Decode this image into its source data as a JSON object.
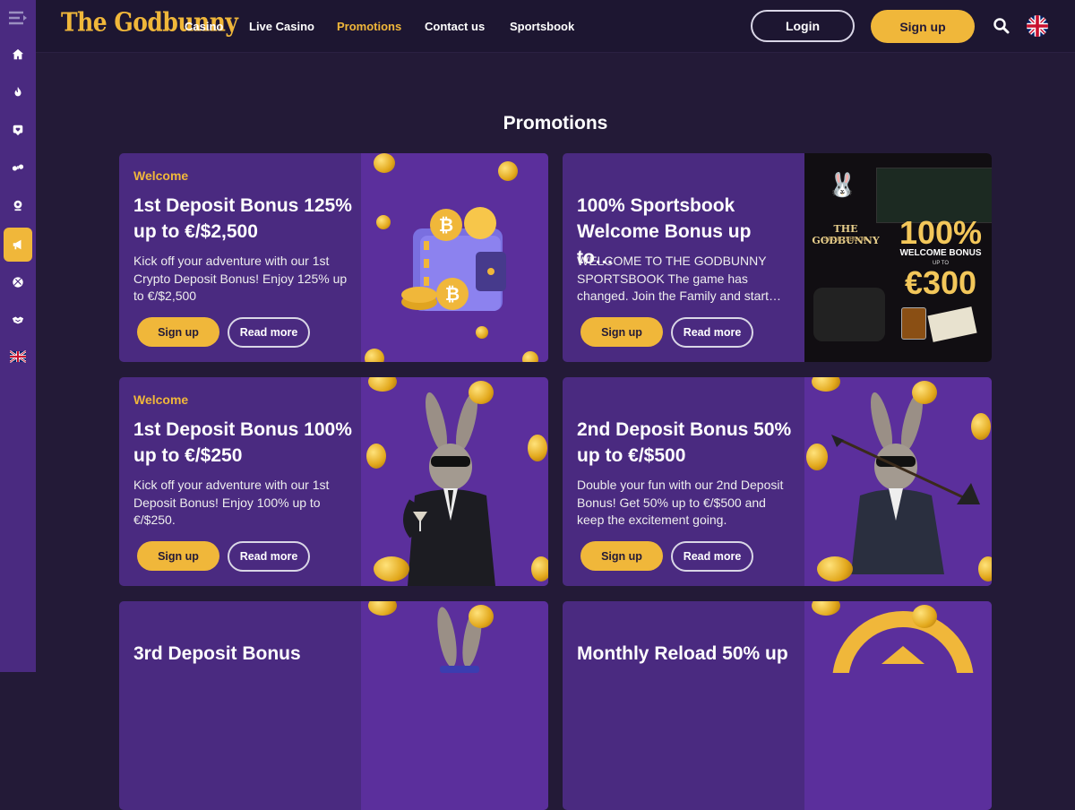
{
  "brand": {
    "logo_text": "The Godbunny"
  },
  "nav": {
    "items": [
      {
        "label": "Casino",
        "active": false
      },
      {
        "label": "Live Casino",
        "active": false
      },
      {
        "label": "Promotions",
        "active": true
      },
      {
        "label": "Contact us",
        "active": false
      },
      {
        "label": "Sportsbook",
        "active": false
      }
    ]
  },
  "header": {
    "login_label": "Login",
    "signup_label": "Sign up"
  },
  "sidebar": {
    "items": [
      {
        "icon": "menu-icon"
      },
      {
        "icon": "home-icon"
      },
      {
        "icon": "fire-icon"
      },
      {
        "icon": "heart-icon"
      },
      {
        "icon": "live-casino-icon"
      },
      {
        "icon": "slots-icon"
      },
      {
        "icon": "megaphone-icon",
        "active": true
      },
      {
        "icon": "sports-ball-icon"
      },
      {
        "icon": "handshake-icon"
      },
      {
        "icon": "uk-flag-icon"
      }
    ]
  },
  "page": {
    "title": "Promotions"
  },
  "promotions": [
    {
      "category": "Welcome",
      "title": "1st Deposit Bonus 125% up to €/$2,500",
      "description": "Kick off your adventure with our 1st Crypto Deposit Bonus! Enjoy 125% up to €/$2,500",
      "signup_label": "Sign up",
      "read_more_label": "Read more"
    },
    {
      "category": "",
      "title": "100% Sportsbook Welcome Bonus up to…",
      "description": "WELCOME TO THE GODBUNNY SPORTSBOOK The game has changed. Join the Family and start…",
      "signup_label": "Sign up",
      "read_more_label": "Read more",
      "art": {
        "brand": "THE GODBUNNY",
        "brand_sub": "SPORTSBOOK",
        "percent": "100%",
        "line1": "WELCOME BONUS",
        "line2": "UP TO",
        "amount": "€300"
      }
    },
    {
      "category": "Welcome",
      "title": "1st Deposit Bonus 100% up to €/$250",
      "description": "Kick off your adventure with our 1st Deposit Bonus! Enjoy 100% up to €/$250.",
      "signup_label": "Sign up",
      "read_more_label": "Read more"
    },
    {
      "category": "",
      "title": "2nd Deposit Bonus 50% up to €/$500",
      "description": "Double your fun with our 2nd Deposit Bonus! Get 50% up to €/$500 and keep the excitement going.",
      "signup_label": "Sign up",
      "read_more_label": "Read more"
    },
    {
      "category": "",
      "title": "3rd Deposit Bonus",
      "description": "",
      "signup_label": "",
      "read_more_label": ""
    },
    {
      "category": "",
      "title": "Monthly Reload 50% up",
      "description": "",
      "signup_label": "",
      "read_more_label": ""
    }
  ],
  "colors": {
    "accent": "#f0b73a",
    "sidebar": "#4a2a80",
    "background": "#231a37",
    "card": "#4a2a80"
  }
}
